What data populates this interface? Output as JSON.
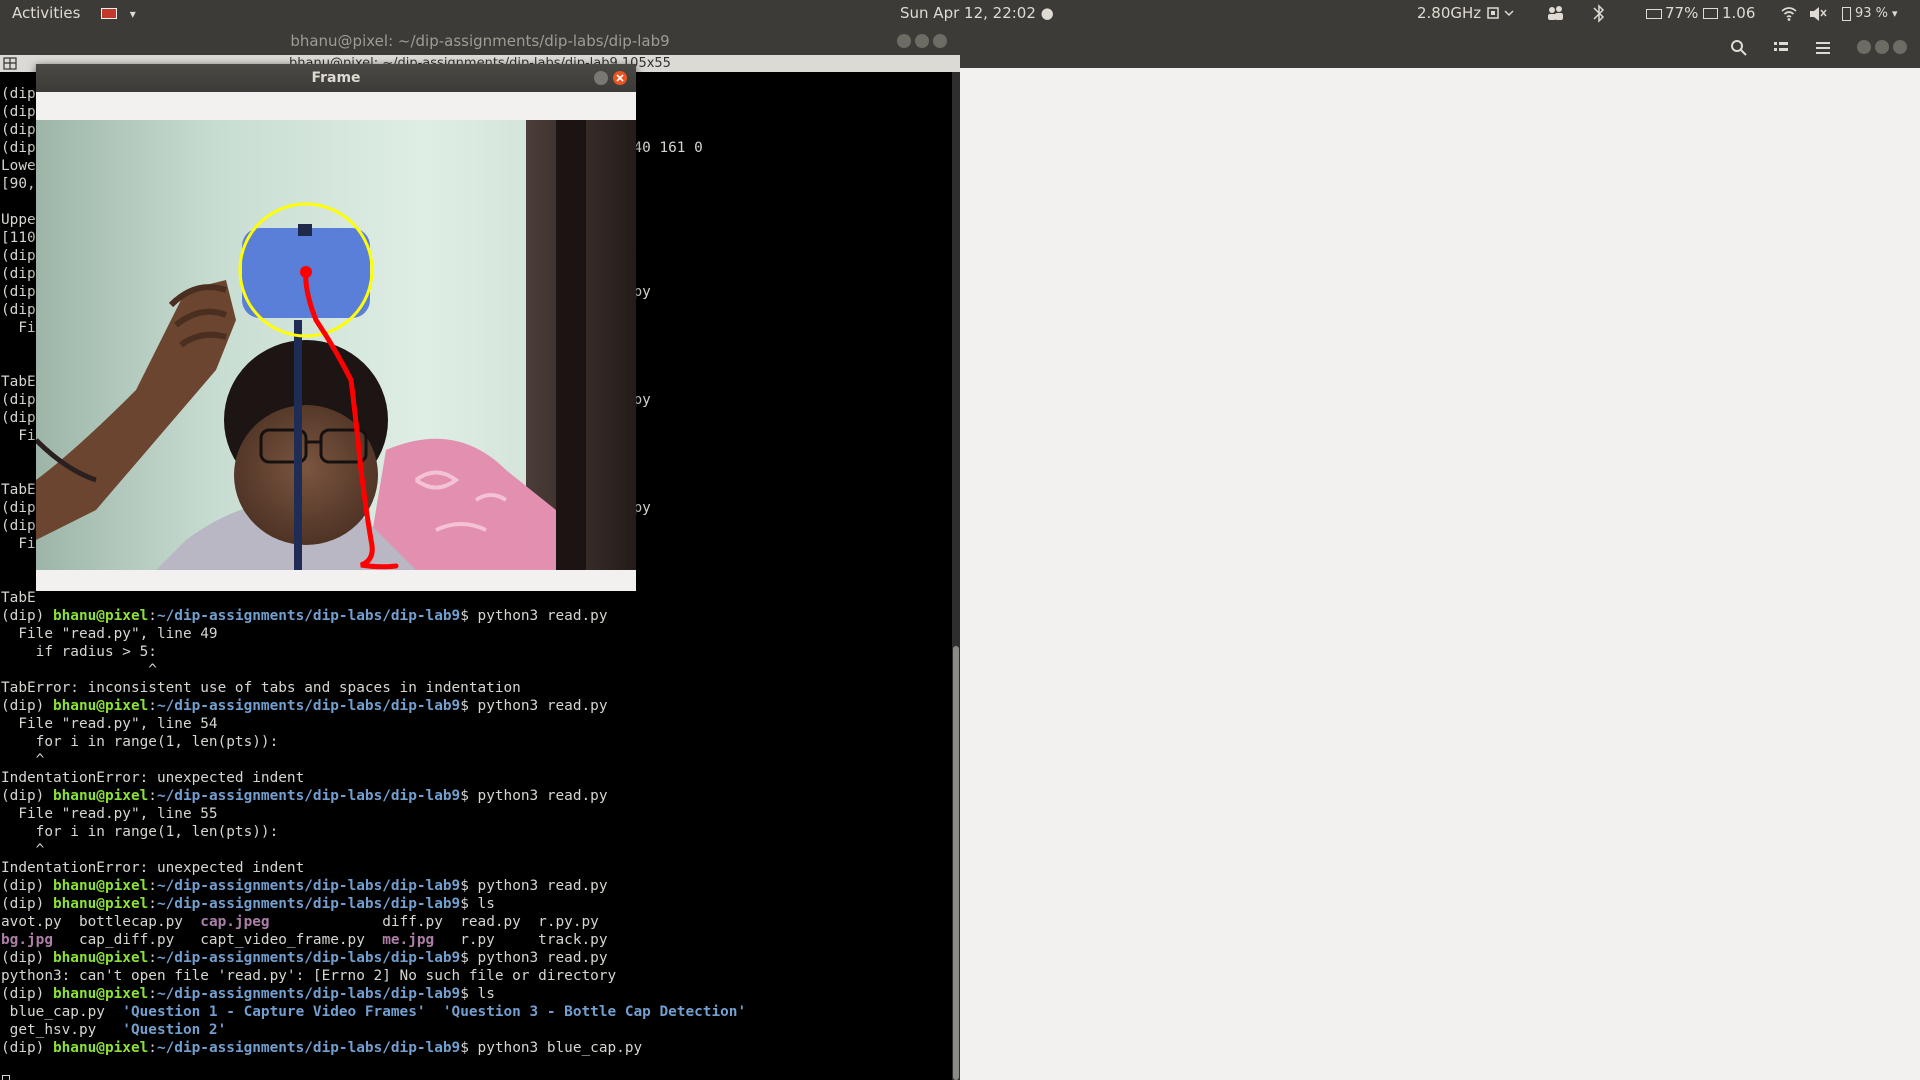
{
  "panel": {
    "activities": "Activities",
    "keyboard_arrow": "▾",
    "clock": "Sun Apr 12, 22:02 ●",
    "cpu_freq": "2.80GHz",
    "battery_pct": "77%",
    "load": "1.06",
    "power_pct": "93 %"
  },
  "terminal": {
    "window_title": "bhanu@pixel: ~/dip-assignments/dip-labs/dip-lab9",
    "tab_title": "bhanu@pixel: ~/dip-assignments/dip-labs/dip-lab9 105x55",
    "lines": [
      {
        "segments": [
          {
            "t": "(dip"
          }
        ]
      },
      {
        "segments": [
          {
            "t": "(dip"
          }
        ]
      },
      {
        "segments": [
          {
            "t": "(dip"
          }
        ]
      },
      {
        "segments": [
          {
            "t": "(dip                                                                    240 161 0"
          }
        ]
      },
      {
        "segments": [
          {
            "t": "Lowe"
          }
        ]
      },
      {
        "segments": [
          {
            "t": "[90,"
          }
        ]
      },
      {
        "segments": [
          {
            "t": ""
          }
        ]
      },
      {
        "segments": [
          {
            "t": "Uppe"
          }
        ]
      },
      {
        "segments": [
          {
            "t": "[110"
          }
        ]
      },
      {
        "segments": [
          {
            "t": "(dip"
          }
        ]
      },
      {
        "segments": [
          {
            "t": "(dip"
          }
        ]
      },
      {
        "segments": [
          {
            "t": "(dip                                                                     py"
          }
        ]
      },
      {
        "segments": [
          {
            "t": "(dip"
          }
        ]
      },
      {
        "segments": [
          {
            "t": "  Fi"
          }
        ]
      },
      {
        "segments": [
          {
            "t": ""
          }
        ]
      },
      {
        "segments": [
          {
            "t": ""
          }
        ]
      },
      {
        "segments": [
          {
            "t": "TabE"
          }
        ]
      },
      {
        "segments": [
          {
            "t": "(dip                                                                     py"
          }
        ]
      },
      {
        "segments": [
          {
            "t": "(dip"
          }
        ]
      },
      {
        "segments": [
          {
            "t": "  Fi"
          }
        ]
      },
      {
        "segments": [
          {
            "t": ""
          }
        ]
      },
      {
        "segments": [
          {
            "t": ""
          }
        ]
      },
      {
        "segments": [
          {
            "t": "TabE"
          }
        ]
      },
      {
        "segments": [
          {
            "t": "(dip                                                                     py"
          }
        ]
      },
      {
        "segments": [
          {
            "t": "(dip"
          }
        ]
      },
      {
        "segments": [
          {
            "t": "  Fi"
          }
        ]
      },
      {
        "segments": [
          {
            "t": ""
          }
        ]
      },
      {
        "segments": [
          {
            "t": ""
          }
        ]
      },
      {
        "segments": [
          {
            "t": "TabE"
          }
        ]
      },
      {
        "segments": [
          {
            "t": "(dip) "
          },
          {
            "t": "bhanu@pixel",
            "c": "green"
          },
          {
            "t": ":",
            "c": "plain"
          },
          {
            "t": "~/dip-assignments/dip-labs/dip-lab9",
            "c": "blue"
          },
          {
            "t": "$ python3 read.py"
          }
        ]
      },
      {
        "segments": [
          {
            "t": "  File \"read.py\", line 49"
          }
        ]
      },
      {
        "segments": [
          {
            "t": "    if radius > 5:"
          }
        ]
      },
      {
        "segments": [
          {
            "t": "                 ^"
          }
        ]
      },
      {
        "segments": [
          {
            "t": "TabError: inconsistent use of tabs and spaces in indentation"
          }
        ]
      },
      {
        "segments": [
          {
            "t": "(dip) "
          },
          {
            "t": "bhanu@pixel",
            "c": "green"
          },
          {
            "t": ":",
            "c": "plain"
          },
          {
            "t": "~/dip-assignments/dip-labs/dip-lab9",
            "c": "blue"
          },
          {
            "t": "$ python3 read.py"
          }
        ]
      },
      {
        "segments": [
          {
            "t": "  File \"read.py\", line 54"
          }
        ]
      },
      {
        "segments": [
          {
            "t": "    for i in range(1, len(pts)):"
          }
        ]
      },
      {
        "segments": [
          {
            "t": "    ^"
          }
        ]
      },
      {
        "segments": [
          {
            "t": "IndentationError: unexpected indent"
          }
        ]
      },
      {
        "segments": [
          {
            "t": "(dip) "
          },
          {
            "t": "bhanu@pixel",
            "c": "green"
          },
          {
            "t": ":",
            "c": "plain"
          },
          {
            "t": "~/dip-assignments/dip-labs/dip-lab9",
            "c": "blue"
          },
          {
            "t": "$ python3 read.py"
          }
        ]
      },
      {
        "segments": [
          {
            "t": "  File \"read.py\", line 55"
          }
        ]
      },
      {
        "segments": [
          {
            "t": "    for i in range(1, len(pts)):"
          }
        ]
      },
      {
        "segments": [
          {
            "t": "    ^"
          }
        ]
      },
      {
        "segments": [
          {
            "t": "IndentationError: unexpected indent"
          }
        ]
      },
      {
        "segments": [
          {
            "t": "(dip) "
          },
          {
            "t": "bhanu@pixel",
            "c": "green"
          },
          {
            "t": ":",
            "c": "plain"
          },
          {
            "t": "~/dip-assignments/dip-labs/dip-lab9",
            "c": "blue"
          },
          {
            "t": "$ python3 read.py"
          }
        ]
      },
      {
        "segments": [
          {
            "t": "(dip) "
          },
          {
            "t": "bhanu@pixel",
            "c": "green"
          },
          {
            "t": ":",
            "c": "plain"
          },
          {
            "t": "~/dip-assignments/dip-labs/dip-lab9",
            "c": "blue"
          },
          {
            "t": "$ ls"
          }
        ]
      },
      {
        "segments": [
          {
            "t": "avot.py  bottlecap.py  "
          },
          {
            "t": "cap.jpeg",
            "c": "magenta"
          },
          {
            "t": "             diff.py  read.py  r.py.py"
          }
        ]
      },
      {
        "segments": [
          {
            "t": "bg.jpg",
            "c": "magenta"
          },
          {
            "t": "   cap_diff.py   capt_video_frame.py  "
          },
          {
            "t": "me.jpg",
            "c": "magenta"
          },
          {
            "t": "   r.py     track.py"
          }
        ]
      },
      {
        "segments": [
          {
            "t": "(dip) "
          },
          {
            "t": "bhanu@pixel",
            "c": "green"
          },
          {
            "t": ":",
            "c": "plain"
          },
          {
            "t": "~/dip-assignments/dip-labs/dip-lab9",
            "c": "blue"
          },
          {
            "t": "$ python3 read.py"
          }
        ]
      },
      {
        "segments": [
          {
            "t": "python3: can't open file 'read.py': [Errno 2] No such file or directory"
          }
        ]
      },
      {
        "segments": [
          {
            "t": "(dip) "
          },
          {
            "t": "bhanu@pixel",
            "c": "green"
          },
          {
            "t": ":",
            "c": "plain"
          },
          {
            "t": "~/dip-assignments/dip-labs/dip-lab9",
            "c": "blue"
          },
          {
            "t": "$ ls"
          }
        ]
      },
      {
        "segments": [
          {
            "t": " blue_cap.py  "
          },
          {
            "t": "'Question 1 - Capture Video Frames'",
            "c": "blue"
          },
          {
            "t": "  "
          },
          {
            "t": "'Question 3 - Bottle Cap Detection'",
            "c": "blue"
          }
        ]
      },
      {
        "segments": [
          {
            "t": " get_hsv.py   "
          },
          {
            "t": "'Question 2'",
            "c": "blue"
          }
        ]
      },
      {
        "segments": [
          {
            "t": "(dip) "
          },
          {
            "t": "bhanu@pixel",
            "c": "green"
          },
          {
            "t": ":",
            "c": "plain"
          },
          {
            "t": "~/dip-assignments/dip-labs/dip-lab9",
            "c": "blue"
          },
          {
            "t": "$ python3 blue_cap.py"
          }
        ]
      }
    ]
  },
  "frame": {
    "title": "Frame"
  },
  "colors": {
    "panel_bg": "#3c3b37",
    "prompt_user": "#8ae234",
    "prompt_path": "#729fcf",
    "image_file": "#ad7fa8",
    "detection_circle": "#ffff00",
    "tracking_trail": "#ff0000",
    "close_button": "#e95420"
  },
  "icons": {
    "panel": [
      "flag-icon",
      "cpu-icon",
      "people-icon",
      "bluetooth-icon",
      "battery-icon",
      "display-icon",
      "wifi-icon",
      "volume-icon",
      "power-battery-icon"
    ],
    "right_header": [
      "search-icon",
      "view-toggle-icon",
      "menu-icon"
    ]
  }
}
